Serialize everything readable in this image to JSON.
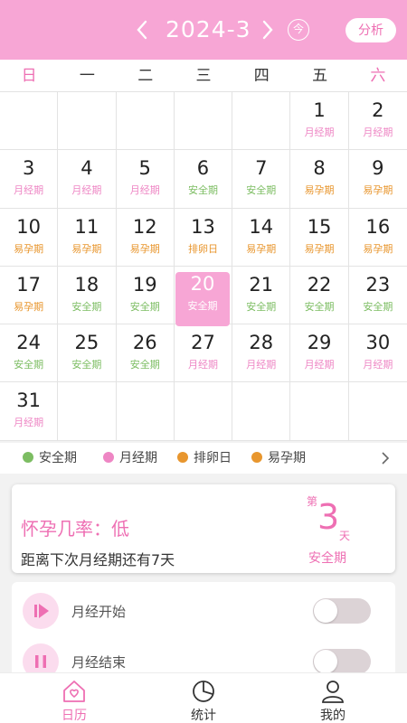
{
  "header": {
    "title": "2024-3",
    "today_label": "今",
    "analyze_label": "分析"
  },
  "weekdays": [
    "日",
    "一",
    "二",
    "三",
    "四",
    "五",
    "六"
  ],
  "colors": {
    "safe": "#7cbd62",
    "period": "#ee86c4",
    "ovulation": "#e8962e",
    "fertile": "#e8962e",
    "accent": "#f7a6d5"
  },
  "calendar": {
    "cells": [
      {
        "d": "",
        "p": "",
        "t": ""
      },
      {
        "d": "",
        "p": "",
        "t": ""
      },
      {
        "d": "",
        "p": "",
        "t": ""
      },
      {
        "d": "",
        "p": "",
        "t": ""
      },
      {
        "d": "",
        "p": "",
        "t": ""
      },
      {
        "d": "1",
        "p": "月经期",
        "t": "period"
      },
      {
        "d": "2",
        "p": "月经期",
        "t": "period"
      },
      {
        "d": "3",
        "p": "月经期",
        "t": "period"
      },
      {
        "d": "4",
        "p": "月经期",
        "t": "period"
      },
      {
        "d": "5",
        "p": "月经期",
        "t": "period"
      },
      {
        "d": "6",
        "p": "安全期",
        "t": "safe"
      },
      {
        "d": "7",
        "p": "安全期",
        "t": "safe"
      },
      {
        "d": "8",
        "p": "易孕期",
        "t": "fertile"
      },
      {
        "d": "9",
        "p": "易孕期",
        "t": "fertile"
      },
      {
        "d": "10",
        "p": "易孕期",
        "t": "fertile"
      },
      {
        "d": "11",
        "p": "易孕期",
        "t": "fertile"
      },
      {
        "d": "12",
        "p": "易孕期",
        "t": "fertile"
      },
      {
        "d": "13",
        "p": "排卵日",
        "t": "ovulation"
      },
      {
        "d": "14",
        "p": "易孕期",
        "t": "fertile"
      },
      {
        "d": "15",
        "p": "易孕期",
        "t": "fertile"
      },
      {
        "d": "16",
        "p": "易孕期",
        "t": "fertile"
      },
      {
        "d": "17",
        "p": "易孕期",
        "t": "fertile"
      },
      {
        "d": "18",
        "p": "安全期",
        "t": "safe"
      },
      {
        "d": "19",
        "p": "安全期",
        "t": "safe"
      },
      {
        "d": "20",
        "p": "安全期",
        "t": "safe",
        "selected": true
      },
      {
        "d": "21",
        "p": "安全期",
        "t": "safe"
      },
      {
        "d": "22",
        "p": "安全期",
        "t": "safe"
      },
      {
        "d": "23",
        "p": "安全期",
        "t": "safe"
      },
      {
        "d": "24",
        "p": "安全期",
        "t": "safe"
      },
      {
        "d": "25",
        "p": "安全期",
        "t": "safe"
      },
      {
        "d": "26",
        "p": "安全期",
        "t": "safe"
      },
      {
        "d": "27",
        "p": "月经期",
        "t": "period"
      },
      {
        "d": "28",
        "p": "月经期",
        "t": "period"
      },
      {
        "d": "29",
        "p": "月经期",
        "t": "period"
      },
      {
        "d": "30",
        "p": "月经期",
        "t": "period"
      },
      {
        "d": "31",
        "p": "月经期",
        "t": "period"
      },
      {
        "d": "",
        "p": "",
        "t": ""
      },
      {
        "d": "",
        "p": "",
        "t": ""
      },
      {
        "d": "",
        "p": "",
        "t": ""
      },
      {
        "d": "",
        "p": "",
        "t": ""
      },
      {
        "d": "",
        "p": "",
        "t": ""
      },
      {
        "d": "",
        "p": "",
        "t": ""
      }
    ]
  },
  "legend": [
    {
      "label": "安全期",
      "t": "safe"
    },
    {
      "label": "月经期",
      "t": "period"
    },
    {
      "label": "排卵日",
      "t": "ovulation"
    },
    {
      "label": "易孕期",
      "t": "fertile"
    }
  ],
  "status_card": {
    "chance": "怀孕几率：低",
    "countdown": "距离下次月经期还有7天",
    "day_prefix": "第",
    "day_number": "3",
    "day_suffix": "天",
    "phase": "安全期"
  },
  "toggles": [
    {
      "label": "月经开始",
      "on": false
    },
    {
      "label": "月经结束",
      "on": false
    }
  ],
  "tabs": [
    {
      "label": "日历",
      "active": true
    },
    {
      "label": "统计",
      "active": false
    },
    {
      "label": "我的",
      "active": false
    }
  ]
}
